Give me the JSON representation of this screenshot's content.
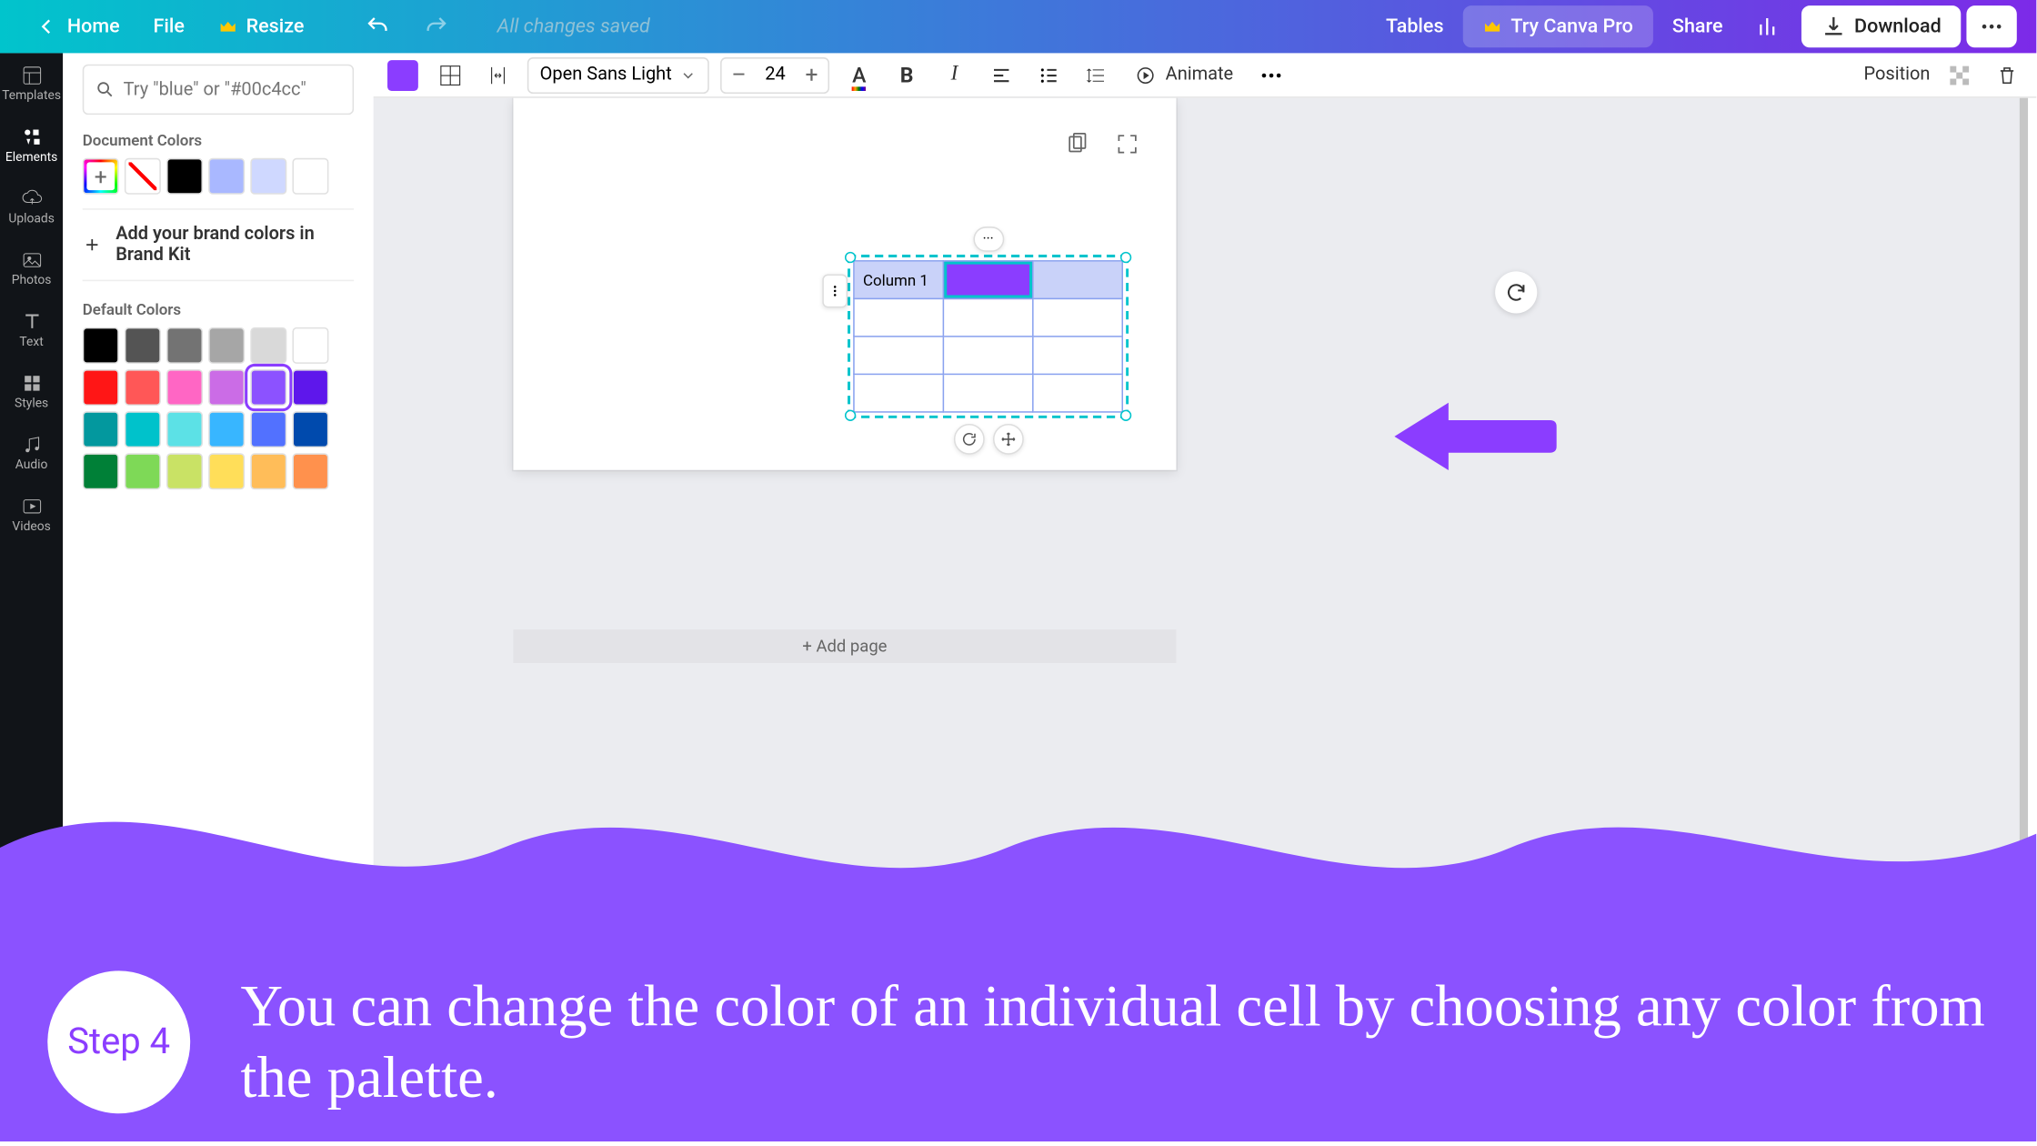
{
  "header": {
    "home": "Home",
    "file": "File",
    "resize": "Resize",
    "saved": "All changes saved",
    "tables": "Tables",
    "trypro": "Try Canva Pro",
    "share": "Share",
    "download": "Download"
  },
  "leftnav": {
    "templates": "Templates",
    "elements": "Elements",
    "uploads": "Uploads",
    "photos": "Photos",
    "text": "Text",
    "styles": "Styles",
    "audio": "Audio",
    "videos": "Videos"
  },
  "colorpanel": {
    "search_placeholder": "Try \"blue\" or \"#00c4cc\"",
    "doc_colors_label": "Document Colors",
    "doc_colors": [
      "#000000",
      "#a9b8ff",
      "#cfd8ff",
      "#ffffff"
    ],
    "brand_label": "Add your brand colors in Brand Kit",
    "default_label": "Default Colors",
    "default_colors": [
      "#000000",
      "#545454",
      "#737373",
      "#a6a6a6",
      "#d9d9d9",
      "#ffffff",
      "#ff1616",
      "#ff5757",
      "#ff66c4",
      "#cb6ce6",
      "#8c52ff",
      "#5e17eb",
      "#03989e",
      "#00c2cb",
      "#5ce1e6",
      "#38b6ff",
      "#5271ff",
      "#004aad",
      "#008037",
      "#7ed957",
      "#c9e265",
      "#ffde59",
      "#ffbd59",
      "#ff914d"
    ],
    "selected_default_index": 10
  },
  "toolbar": {
    "font": "Open Sans Light",
    "size": "24",
    "animate": "Animate",
    "position": "Position"
  },
  "canvas": {
    "table_header_cell": "Column 1",
    "add_page": "+ Add page"
  },
  "tutorial": {
    "step_label": "Step 4",
    "text": "You can change the color of an individual cell by choosing any color from the palette."
  }
}
